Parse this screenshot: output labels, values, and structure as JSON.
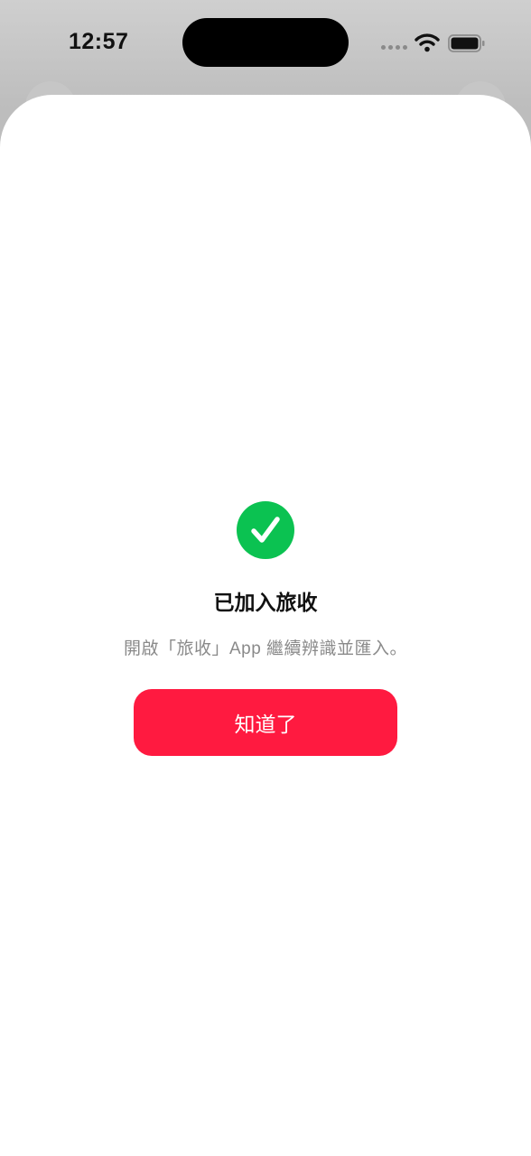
{
  "status_bar": {
    "time": "12:57",
    "icons": [
      "signal-icon",
      "wifi-icon",
      "battery-icon"
    ]
  },
  "dialog": {
    "icon": "check-circle-icon",
    "title": "已加入旅收",
    "message": "開啟「旅收」App 繼續辨識並匯入。",
    "button_label": "知道了"
  },
  "colors": {
    "success_green": "#0bc251",
    "button_red": "#ff1a40",
    "title_text": "#111111",
    "secondary_text": "#8a8a8a"
  }
}
